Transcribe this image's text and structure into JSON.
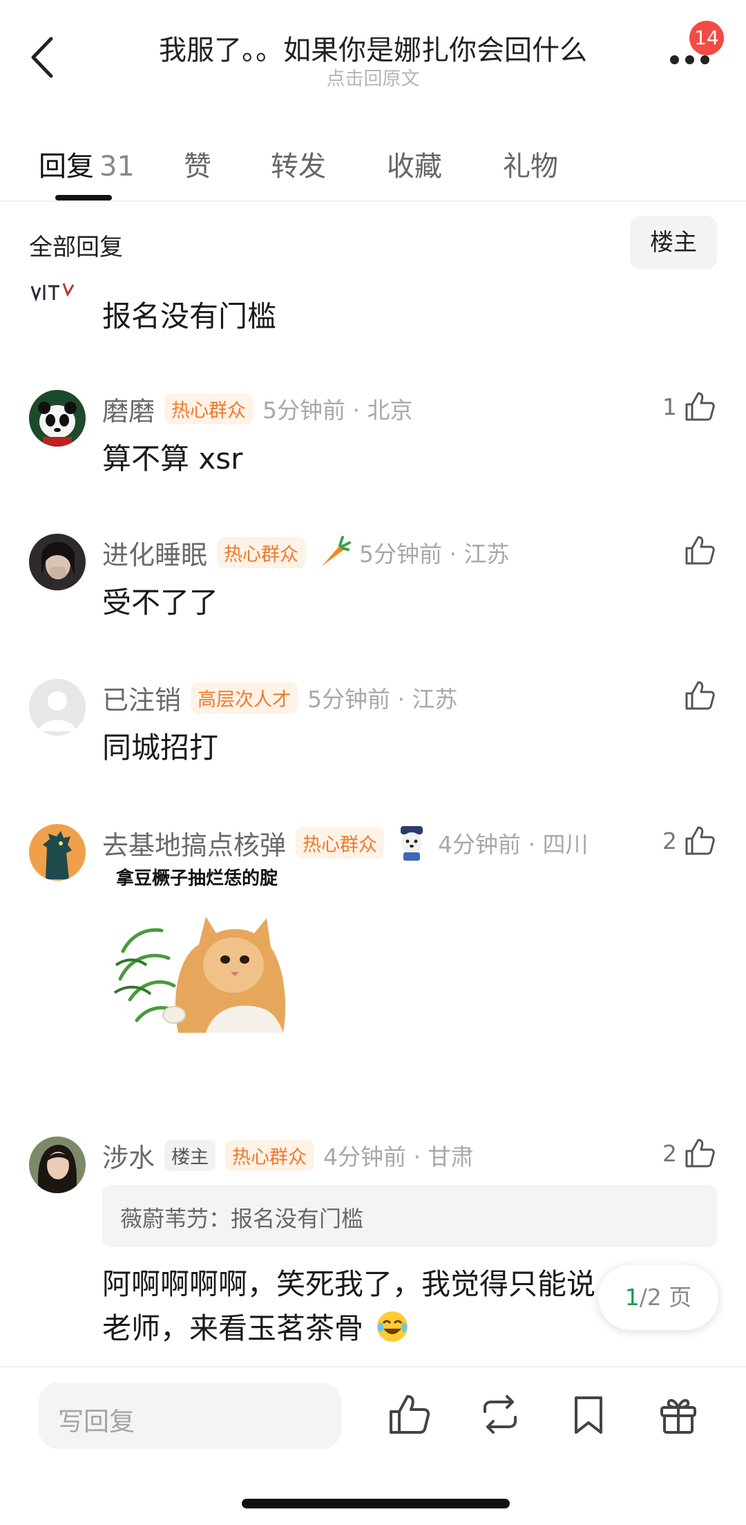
{
  "header": {
    "title": "我服了。。如果你是娜扎你会回什么",
    "subtitle": "点击回原文",
    "badge": "14"
  },
  "tabs": [
    {
      "label": "回复",
      "count": "31"
    },
    {
      "label": "赞"
    },
    {
      "label": "转发"
    },
    {
      "label": "收藏"
    },
    {
      "label": "礼物"
    }
  ],
  "filter": {
    "label": "全部回复",
    "op_button": "楼主"
  },
  "partial_comment": {
    "text": "报名没有门槛"
  },
  "comments": [
    {
      "name": "磨磨",
      "tag": "热心群众",
      "time": "5分钟前 · 北京",
      "likes": "1",
      "text": "算不算 xsr"
    },
    {
      "name": "进化睡眠",
      "tag": "热心群众",
      "time": "5分钟前 · 江苏",
      "likes": "",
      "text": "受不了了"
    },
    {
      "name": "已注销",
      "tag": "高层次人才",
      "time": "5分钟前 · 江苏",
      "likes": "",
      "text": "同城招打"
    },
    {
      "name": "去基地搞点核弹",
      "tag": "热心群众",
      "time": "4分钟前 · 四川",
      "likes": "2",
      "sticker_caption": "拿豆橛子抽烂恁的腚"
    },
    {
      "name": "涉水",
      "op_tag": "楼主",
      "tag": "热心群众",
      "time": "4分钟前 · 甘肃",
      "likes": "2",
      "quote": "薇蔚苇芀：报名没有门槛",
      "text_line1": "阿啊啊啊啊，笑死我了，我觉得只能说",
      "text_line2": "老师，来看玉茗茶骨"
    }
  ],
  "pagination": {
    "current": "1",
    "total": "/2 页"
  },
  "bottom": {
    "reply_placeholder": "写回复"
  },
  "colors": {
    "accent_orange": "#ef7a2c",
    "badge_red": "#f24a45",
    "page_green": "#1a9b4b"
  }
}
